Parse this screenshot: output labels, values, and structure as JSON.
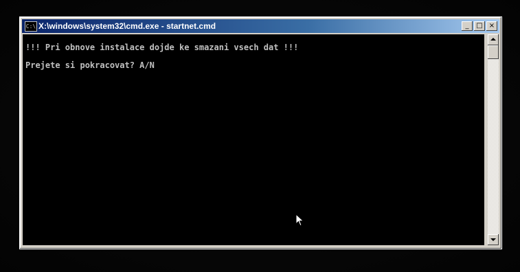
{
  "window": {
    "title": "X:\\windows\\system32\\cmd.exe - startnet.cmd",
    "app_icon": "C:\\",
    "controls": {
      "minimize_glyph": "_",
      "maximize_glyph": "□",
      "close_glyph": "×"
    }
  },
  "console": {
    "lines": [
      "!!! Pri obnove instalace dojde ke smazani vsech dat !!!",
      "Prejete si pokracovat? A/N"
    ],
    "text_color": "#c0c0c0",
    "background": "#000000"
  },
  "icons": {
    "app": "cmd-console-icon",
    "pointer": "mouse-pointer-icon",
    "scroll_up": "scroll-up-arrow-icon",
    "scroll_down": "scroll-down-arrow-icon"
  }
}
